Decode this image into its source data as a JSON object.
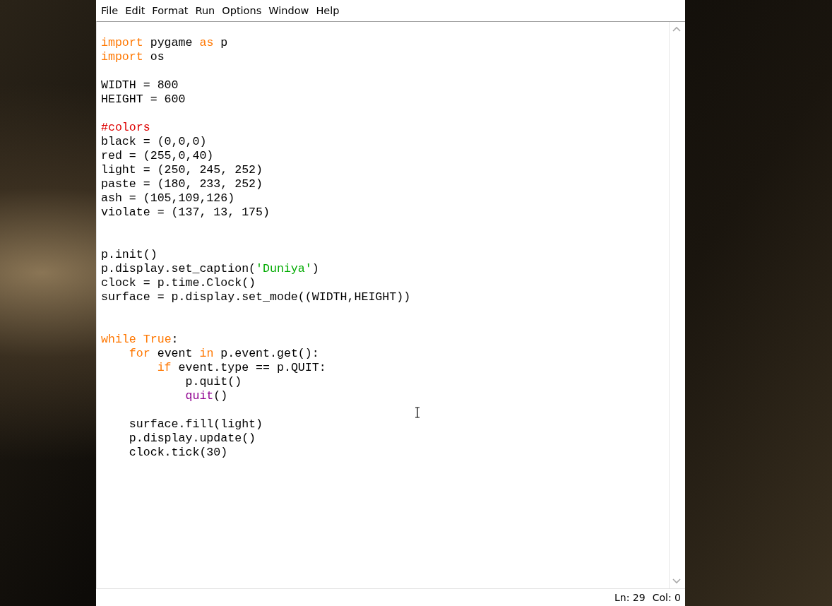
{
  "menu": [
    {
      "label": "File"
    },
    {
      "label": "Edit"
    },
    {
      "label": "Format"
    },
    {
      "label": "Run"
    },
    {
      "label": "Options"
    },
    {
      "label": "Window"
    },
    {
      "label": "Help"
    }
  ],
  "editor": {
    "lines": [
      {
        "kind": "code",
        "tokens": [
          {
            "text": "import",
            "kind": "keyword"
          },
          {
            "text": " pygame ",
            "kind": "plain"
          },
          {
            "text": "as",
            "kind": "keyword"
          },
          {
            "text": " p",
            "kind": "plain"
          }
        ]
      },
      {
        "kind": "code",
        "tokens": [
          {
            "text": "import",
            "kind": "keyword"
          },
          {
            "text": " os",
            "kind": "plain"
          }
        ]
      },
      {
        "kind": "blank"
      },
      {
        "kind": "code",
        "tokens": [
          {
            "text": "WIDTH = 800",
            "kind": "plain"
          }
        ]
      },
      {
        "kind": "code",
        "tokens": [
          {
            "text": "HEIGHT = 600",
            "kind": "plain"
          }
        ]
      },
      {
        "kind": "blank"
      },
      {
        "kind": "code",
        "tokens": [
          {
            "text": "#colors",
            "kind": "comment"
          }
        ]
      },
      {
        "kind": "code",
        "tokens": [
          {
            "text": "black = (0,0,0)",
            "kind": "plain"
          }
        ]
      },
      {
        "kind": "code",
        "tokens": [
          {
            "text": "red = (255,0,40)",
            "kind": "plain"
          }
        ]
      },
      {
        "kind": "code",
        "tokens": [
          {
            "text": "light = (250, 245, 252)",
            "kind": "plain"
          }
        ]
      },
      {
        "kind": "code",
        "tokens": [
          {
            "text": "paste = (180, 233, 252)",
            "kind": "plain"
          }
        ]
      },
      {
        "kind": "code",
        "tokens": [
          {
            "text": "ash = (105,109,126)",
            "kind": "plain"
          }
        ]
      },
      {
        "kind": "code",
        "tokens": [
          {
            "text": "violate = (137, 13, 175)",
            "kind": "plain"
          }
        ]
      },
      {
        "kind": "blank"
      },
      {
        "kind": "blank"
      },
      {
        "kind": "code",
        "tokens": [
          {
            "text": "p.init()",
            "kind": "plain"
          }
        ]
      },
      {
        "kind": "code",
        "tokens": [
          {
            "text": "p.display.set_caption(",
            "kind": "plain"
          },
          {
            "text": "'Duniya'",
            "kind": "string"
          },
          {
            "text": ")",
            "kind": "plain"
          }
        ]
      },
      {
        "kind": "code",
        "tokens": [
          {
            "text": "clock = p.time.Clock()",
            "kind": "plain"
          }
        ]
      },
      {
        "kind": "code",
        "tokens": [
          {
            "text": "surface = p.display.set_mode((WIDTH,HEIGHT))",
            "kind": "plain"
          }
        ]
      },
      {
        "kind": "blank"
      },
      {
        "kind": "blank"
      },
      {
        "kind": "code",
        "tokens": [
          {
            "text": "while",
            "kind": "keyword"
          },
          {
            "text": " True",
            "kind": "keyword"
          },
          {
            "text": ":",
            "kind": "plain"
          }
        ]
      },
      {
        "kind": "code",
        "tokens": [
          {
            "text": "    for",
            "kind": "keyword"
          },
          {
            "text": " event ",
            "kind": "plain"
          },
          {
            "text": "in",
            "kind": "keyword"
          },
          {
            "text": " p.event.get():",
            "kind": "plain"
          }
        ]
      },
      {
        "kind": "code",
        "tokens": [
          {
            "text": "        if",
            "kind": "keyword"
          },
          {
            "text": " event.type == p.QUIT:",
            "kind": "plain"
          }
        ]
      },
      {
        "kind": "code",
        "tokens": [
          {
            "text": "            p.quit()",
            "kind": "plain"
          }
        ]
      },
      {
        "kind": "code",
        "tokens": [
          {
            "text": "            quit",
            "kind": "builtin"
          },
          {
            "text": "()",
            "kind": "plain"
          }
        ]
      },
      {
        "kind": "blank"
      },
      {
        "kind": "code",
        "tokens": [
          {
            "text": "    surface.fill(light)",
            "kind": "plain"
          }
        ]
      },
      {
        "kind": "code",
        "tokens": [
          {
            "text": "    p.display.update()",
            "kind": "plain"
          }
        ]
      },
      {
        "kind": "code",
        "tokens": [
          {
            "text": "    clock.tick(30)",
            "kind": "plain"
          }
        ]
      }
    ]
  },
  "status_bar": {
    "line": "Ln: 29",
    "column": "Col: 0"
  }
}
